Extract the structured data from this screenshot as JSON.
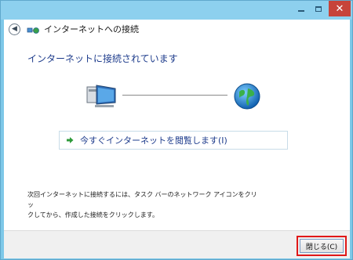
{
  "window": {
    "minimize_glyph": "",
    "close_glyph": "✕"
  },
  "header": {
    "back_glyph": "◀",
    "title": "インターネットへの接続"
  },
  "main": {
    "heading": "インターネットに接続されています",
    "browse_option": "今すぐインターネットを閲覧します(I)",
    "note_lines": [
      "次回インターネットに接続するには、タスク バーのネットワーク アイコンをクリッ",
      "クしてから、作成した接続をクリックします。"
    ]
  },
  "footer": {
    "close_button": "閉じる(C)"
  },
  "colors": {
    "frame": "#8dd0ee",
    "heading": "#1e3c8c",
    "close_caption": "#c7443a",
    "highlight": "#e01818"
  }
}
